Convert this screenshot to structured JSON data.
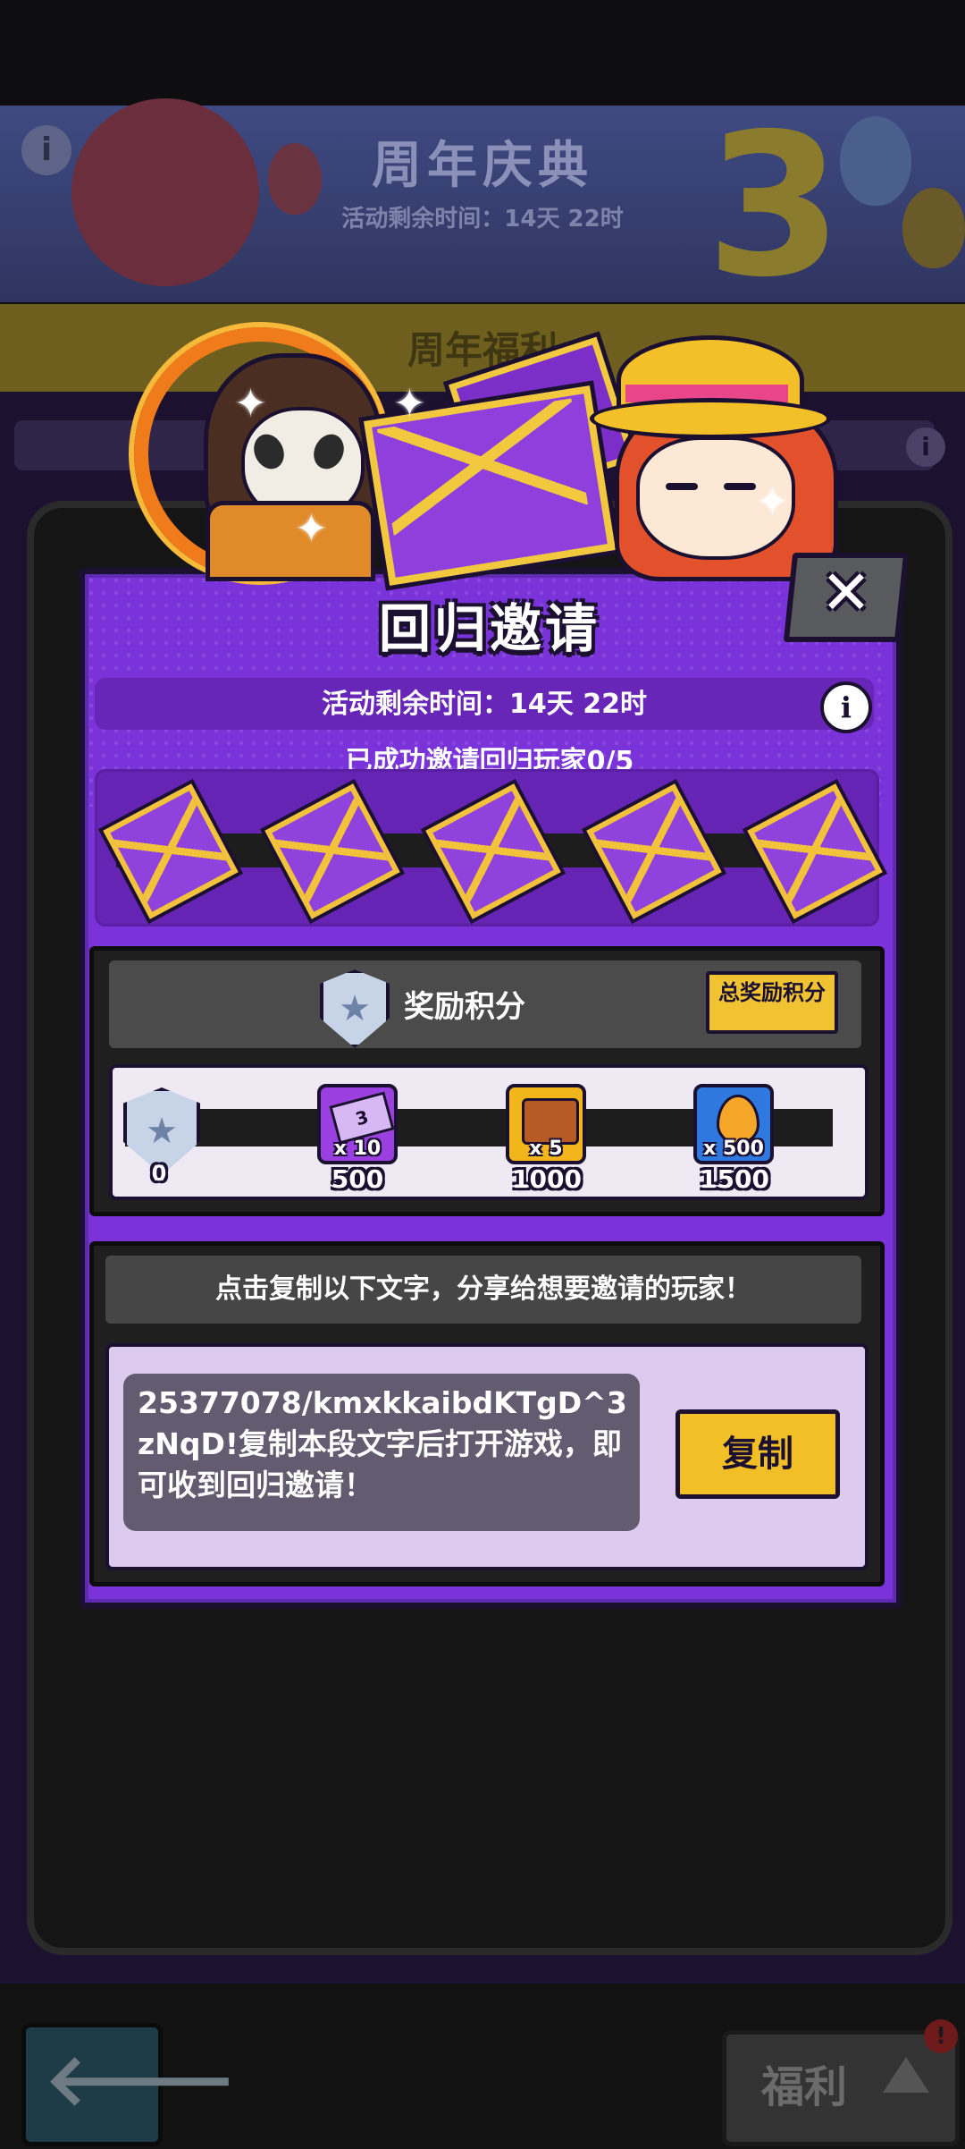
{
  "background": {
    "event_title": "周年庆典",
    "event_timer": "活动剩余时间：14天 22时",
    "anniversary_number": "3",
    "tab_title": "周年福利",
    "info_icon": "i",
    "back_icon": "left-arrow-icon",
    "welfare_button": "福利",
    "alert_badge": "!"
  },
  "modal": {
    "title": "回归邀请",
    "close_icon": "✕",
    "timer_text": "活动剩余时间：14天 22时",
    "info_icon": "i",
    "invited_text": "已成功邀请回归玩家0/5",
    "envelopes_total": 5,
    "envelopes_filled": 0
  },
  "rewards": {
    "title": "奖励积分",
    "total_button": "总奖励积分",
    "milestones": [
      {
        "label": "0",
        "icon": "shield-star-icon",
        "qty": ""
      },
      {
        "label": "500",
        "icon": "ticket-icon",
        "qty": "x 10",
        "badge": "3"
      },
      {
        "label": "1000",
        "icon": "treasure-chest-icon",
        "qty": "x 5"
      },
      {
        "label": "1500",
        "icon": "flame-drop-icon",
        "qty": "x 500"
      }
    ]
  },
  "share": {
    "instruction": "点击复制以下文字，分享给想要邀请的玩家！",
    "code_text": "25377078/kmxkkaibdKTgD^3zNqD!复制本段文字后打开游戏，即可收到回归邀请！",
    "copy_button": "复制"
  },
  "colors": {
    "modal_purple": "#7a33d8",
    "accent_yellow": "#f2bf27",
    "dark_outline": "#1b1030"
  }
}
